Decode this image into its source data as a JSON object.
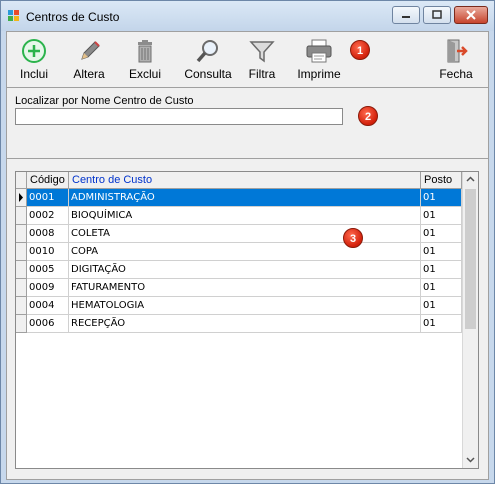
{
  "window": {
    "title": "Centros de Custo"
  },
  "toolbar": {
    "inclui": "Inclui",
    "altera": "Altera",
    "exclui": "Exclui",
    "consulta": "Consulta",
    "filtra": "Filtra",
    "imprime": "Imprime",
    "fecha": "Fecha"
  },
  "search": {
    "label": "Localizar por Nome Centro de Custo",
    "value": ""
  },
  "badges": {
    "one": "1",
    "two": "2",
    "three": "3"
  },
  "grid": {
    "headers": {
      "codigo": "Código",
      "centro": "Centro de Custo",
      "posto": "Posto"
    },
    "rows": [
      {
        "codigo": "0001",
        "centro": "ADMINISTRAÇÃO",
        "posto": "01"
      },
      {
        "codigo": "0002",
        "centro": "BIOQUÍMICA",
        "posto": "01"
      },
      {
        "codigo": "0008",
        "centro": "COLETA",
        "posto": "01"
      },
      {
        "codigo": "0010",
        "centro": "COPA",
        "posto": "01"
      },
      {
        "codigo": "0005",
        "centro": "DIGITAÇÃO",
        "posto": "01"
      },
      {
        "codigo": "0009",
        "centro": "FATURAMENTO",
        "posto": "01"
      },
      {
        "codigo": "0004",
        "centro": "HEMATOLOGIA",
        "posto": "01"
      },
      {
        "codigo": "0006",
        "centro": "RECEPÇÃO",
        "posto": "01"
      }
    ]
  },
  "colors": {
    "selection": "#0078d7",
    "header_blue_text": "#0033cc",
    "badge": "#d2200b"
  }
}
